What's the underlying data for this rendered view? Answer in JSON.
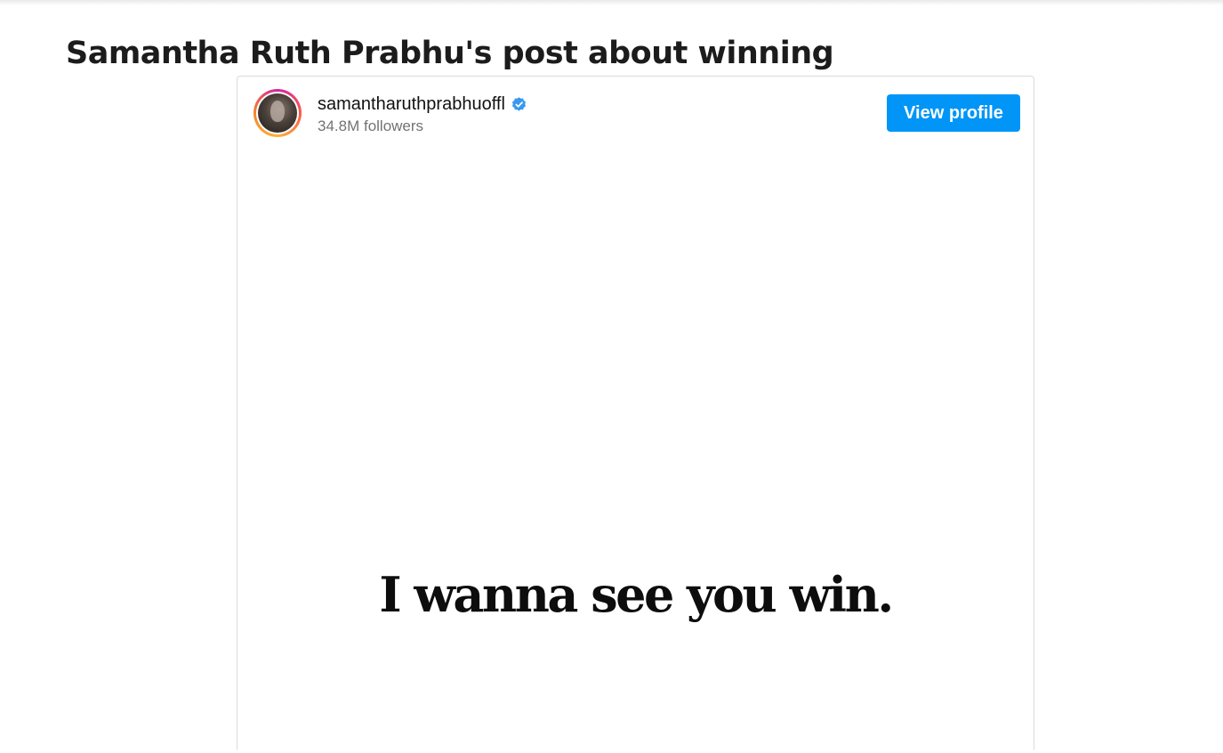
{
  "article": {
    "title": "Samantha Ruth Prabhu's post about winning"
  },
  "embed": {
    "username": "samantharuthprabhuoffl",
    "verified_icon": "verified-badge-icon",
    "followers": "34.8M followers",
    "view_profile_label": "View profile",
    "post_text": "I wanna see you win.",
    "colors": {
      "button_bg": "#0095f6",
      "verified": "#3897f0",
      "followers_text": "#737373"
    }
  }
}
